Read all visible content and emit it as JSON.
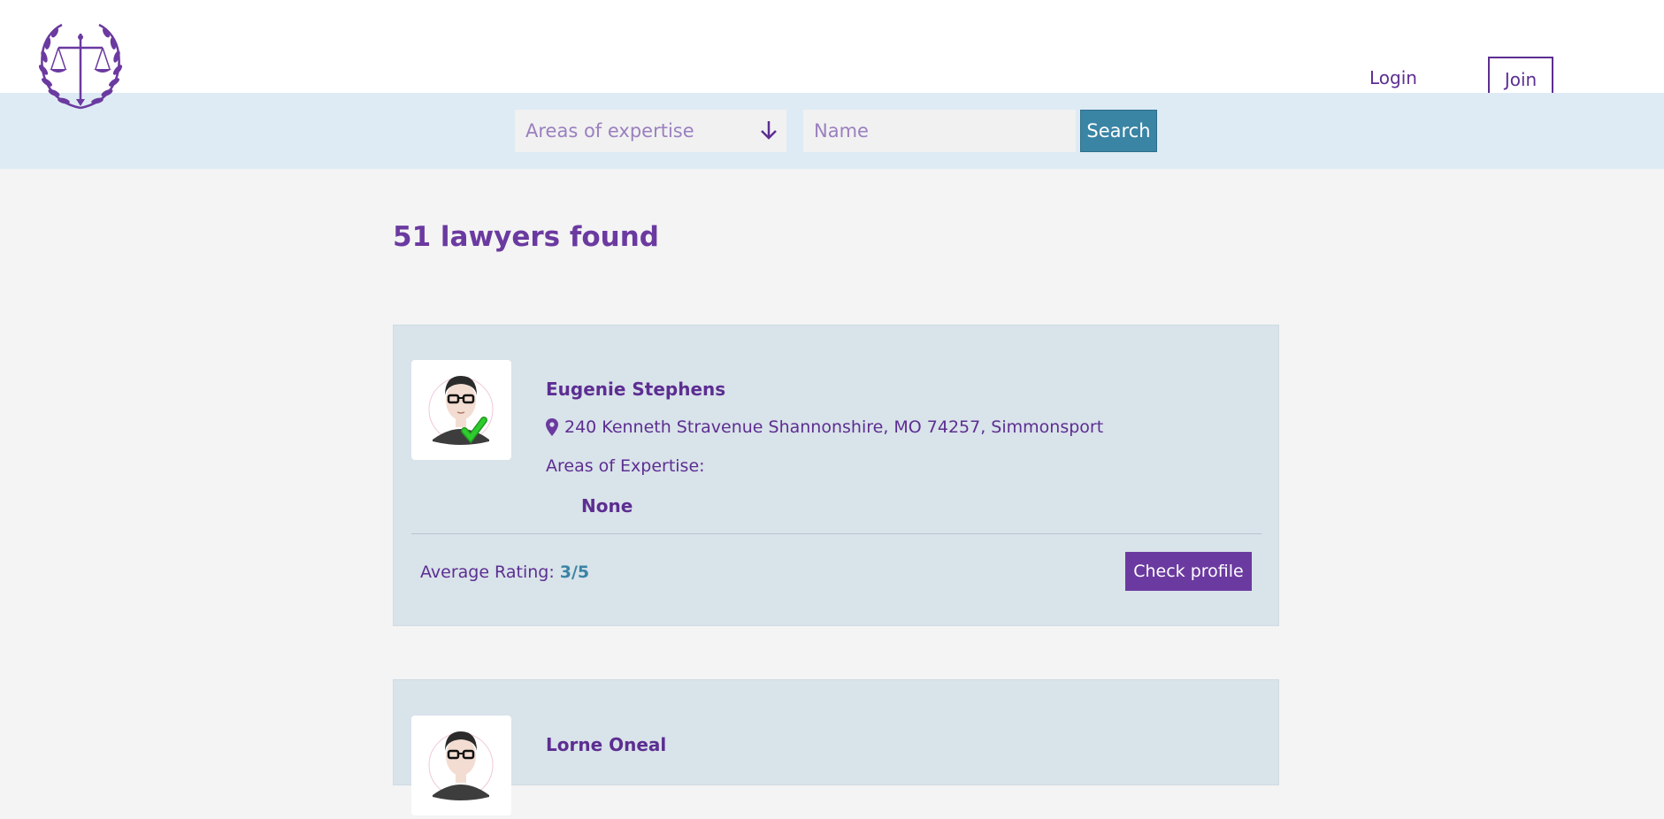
{
  "header": {
    "logo_icon": "scales-of-justice-laurel-icon",
    "login_label": "Login",
    "join_label": "Join"
  },
  "search": {
    "expertise_select": "Areas of expertise",
    "expertise_arrow_icon": "arrow-down-icon",
    "name_placeholder": "Name",
    "button_label": "Search"
  },
  "results": {
    "heading": "51 lawyers found",
    "lawyers": [
      {
        "name": "Eugenie Stephens",
        "address": "240 Kenneth Stravenue Shannonshire, MO 74257, Simmonsport",
        "expertise_label": "Areas of Expertise:",
        "expertise_value": "None",
        "rating_label": "Average Rating:",
        "rating_value": "3/5",
        "button_label": "Check profile",
        "avatar_icon": "verified-avatar-icon"
      },
      {
        "name": "Lorne Oneal",
        "avatar_icon": "verified-avatar-icon"
      }
    ]
  },
  "colors": {
    "brand_purple": "#5c2e91",
    "button_purple": "#6b3aa0",
    "search_blue": "#3a84a4",
    "band_blue": "#deebf4",
    "card_bg": "#d9e3ea",
    "page_bg": "#f4f4f4",
    "verified_green": "#2ecc2e"
  }
}
